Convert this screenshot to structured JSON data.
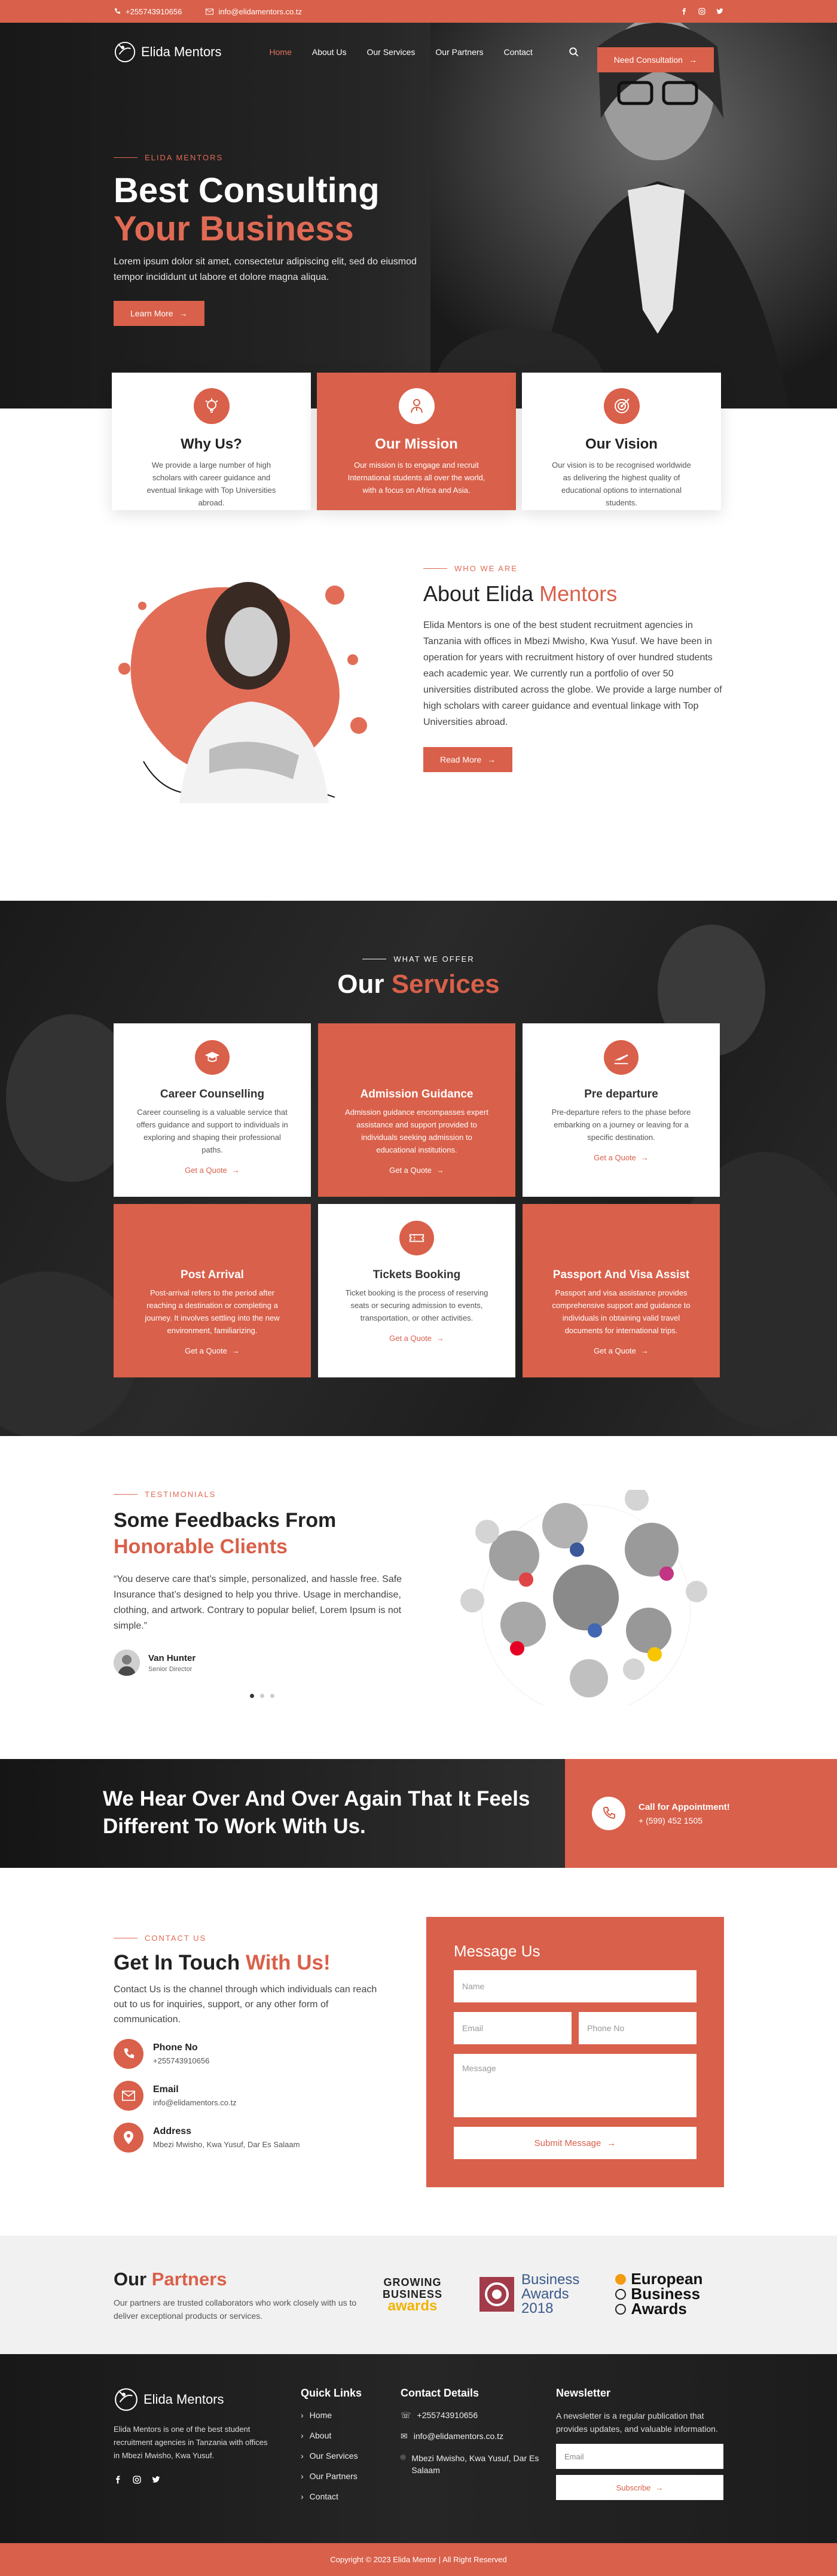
{
  "topbar": {
    "phone": "+255743910656",
    "email": "info@elidamentors.co.tz",
    "social_icons": [
      "facebook-icon",
      "instagram-icon",
      "twitter-icon"
    ]
  },
  "nav": {
    "logo_text": "Elida Mentors",
    "items": [
      "Home",
      "About Us",
      "Our Services",
      "Our Partners",
      "Contact"
    ],
    "active_index": 0,
    "cta_label": "Need Consultation"
  },
  "hero": {
    "eyebrow": "ELIDA MENTORS",
    "title_line1": "Best Consulting",
    "title_line2": "Your Business",
    "subtitle": "Lorem ipsum dolor sit amet, consectetur adipiscing elit, sed do eiusmod tempor incididunt ut labore et dolore magna aliqua.",
    "button_label": "Learn More"
  },
  "features": [
    {
      "title": "Why Us?",
      "text": "We provide a large number of high scholars with career guidance and eventual linkage with Top Universities abroad.",
      "icon": "light-bulb-icon"
    },
    {
      "title": "Our Mission",
      "text": "Our mission is to engage and recruit International students all over the world, with a focus on Africa and Asia.",
      "icon": "mission-icon"
    },
    {
      "title": "Our Vision",
      "text": "Our vision is to be recognised worldwide as delivering the highest quality of educational options to international students.",
      "icon": "target-icon"
    }
  ],
  "about": {
    "eyebrow": "WHO WE ARE",
    "title_prefix": "About Elida",
    "title_accent": "Mentors",
    "text": "Elida Mentors is one of the best student recruitment agencies in Tanzania with offices in Mbezi Mwisho, Kwa Yusuf. We have been in operation for years with recruitment history of over hundred students each academic year. We currently run a portfolio of over 50 universities distributed across the globe. We provide a large number of high scholars with career guidance and eventual linkage with Top Universities abroad.",
    "button_label": "Read More"
  },
  "services": {
    "eyebrow": "WHAT WE OFFER",
    "title_prefix": "Our",
    "title_accent": "Services",
    "quote_label": "Get a Quote",
    "items": [
      {
        "title": "Career Counselling",
        "text": "Career counseling is a valuable service that offers guidance and support to individuals in exploring and shaping their professional paths.",
        "icon": "graduation-cap-icon"
      },
      {
        "title": "Admission Guidance",
        "text": "Admission guidance encompasses expert assistance and support provided to individuals seeking admission to educational institutions.",
        "icon": "admission-icon"
      },
      {
        "title": "Pre departure",
        "text": "Pre-departure refers to the phase before embarking on a journey or leaving for a specific destination.",
        "icon": "plane-departure-icon"
      },
      {
        "title": "Post Arrival",
        "text": "Post-arrival refers to the period after reaching a destination or completing a journey. It involves settling into the new environment, familiarizing.",
        "icon": "plane-arrival-icon"
      },
      {
        "title": "Tickets Booking",
        "text": "Ticket booking is the process of reserving seats or securing admission to events, transportation, or other activities.",
        "icon": "ticket-icon"
      },
      {
        "title": "Passport And Visa Assist",
        "text": "Passport and visa assistance provides comprehensive support and guidance to individuals in obtaining valid travel documents for international trips.",
        "icon": "passport-icon"
      }
    ]
  },
  "testimonials": {
    "eyebrow": "TESTIMONIALS",
    "title_line1": "Some Feedbacks From",
    "title_line2": "Honorable Clients",
    "quote": "“You deserve care that’s simple, personalized, and hassle free. Safe Insurance that’s designed to help you thrive. Usage in merchandise, clothing, and artwork. Contrary to popular belief, Lorem Ipsum is not simple.”",
    "name": "Van Hunter",
    "role": "Senior Director"
  },
  "banner": {
    "text": "We Hear Over And Over Again That It Feels Different To Work With Us.",
    "call_title": "Call for Appointment!",
    "call_number": "+ (599) 452 1505"
  },
  "contact": {
    "eyebrow": "CONTACT US",
    "title_prefix": "Get In Touch",
    "title_accent": "With Us!",
    "intro": "Contact Us is the channel through which individuals can reach out to us for inquiries, support, or any other form of communication.",
    "items": [
      {
        "label": "Phone No",
        "value": "+255743910656",
        "icon": "phone-icon"
      },
      {
        "label": "Email",
        "value": "info@elidamentors.co.tz",
        "icon": "mail-icon"
      },
      {
        "label": "Address",
        "value": "Mbezi Mwisho, Kwa Yusuf, Dar Es Salaam",
        "icon": "location-pin-icon"
      }
    ],
    "form": {
      "title": "Message Us",
      "name_placeholder": "Name",
      "email_placeholder": "Email",
      "phone_placeholder": "Phone No",
      "message_placeholder": "Message",
      "submit_label": "Submit Message"
    }
  },
  "partners": {
    "title_prefix": "Our",
    "title_accent": "Partners",
    "text": "Our partners are trusted collaborators who work closely with us to deliver exceptional products or services.",
    "logos": [
      {
        "l1": "GROWING",
        "l2": "BUSINESS",
        "l3": "awards"
      },
      {
        "l1": "Business",
        "l2": "Awards",
        "l3": "2018"
      },
      {
        "l1": "European",
        "l2": "Business",
        "l3": "Awards"
      }
    ]
  },
  "footer": {
    "logo_text": "Elida Mentors",
    "about": "Elida Mentors is one of the best student recruitment agencies in Tanzania with offices in Mbezi Mwisho, Kwa Yusuf.",
    "quick_links_title": "Quick Links",
    "quick_links": [
      "Home",
      "About",
      "Our Services",
      "Our Partners",
      "Contact"
    ],
    "contact_title": "Contact Details",
    "contact_phone": "+255743910656",
    "contact_email": "info@elidamentors.co.tz",
    "contact_address": "Mbezi Mwisho, Kwa Yusuf, Dar Es Salaam",
    "newsletter_title": "Newsletter",
    "newsletter_text": "A newsletter is a regular publication that provides updates, and valuable information.",
    "newsletter_placeholder": "Email",
    "subscribe_label": "Subscribe",
    "copyright": "Copyright © 2023 Elida Mentor | All Right Reserved"
  },
  "colors": {
    "accent": "#d9604a",
    "dark": "#1e1e1e",
    "light_bg": "#f1f1f1"
  }
}
